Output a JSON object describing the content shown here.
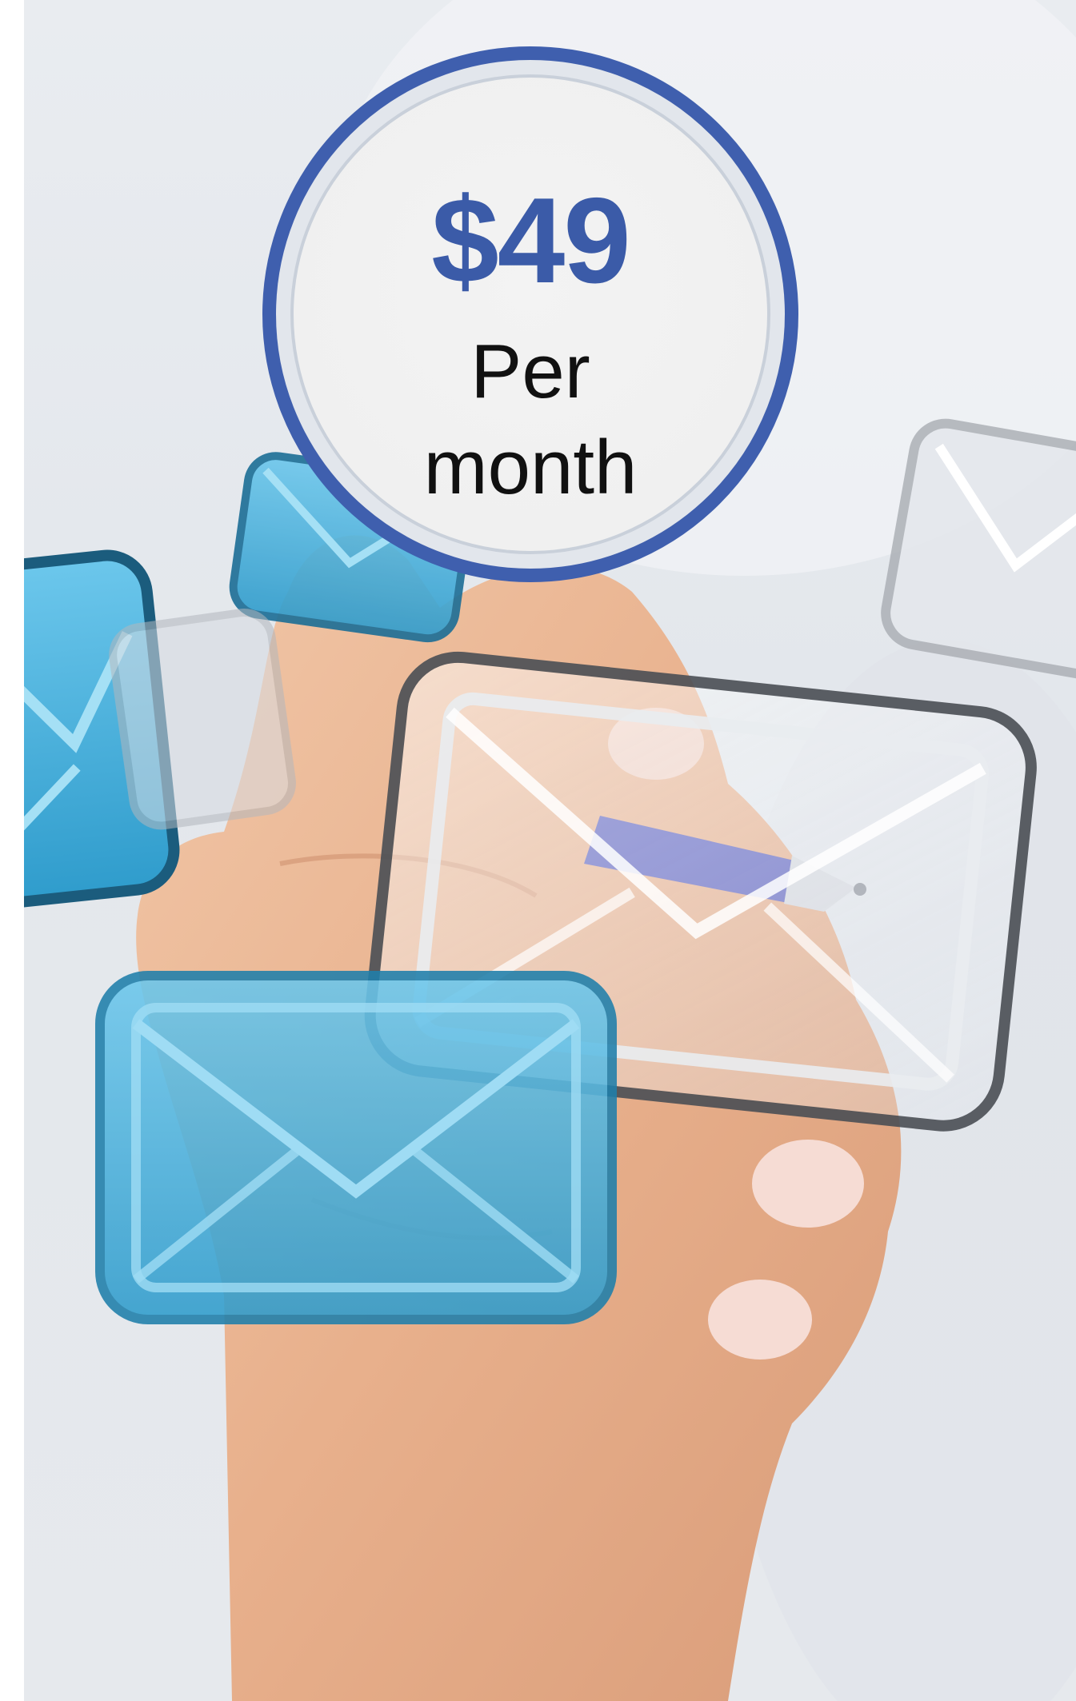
{
  "pricing": {
    "amount": "$49",
    "period_line1": "Per",
    "period_line2": "month"
  },
  "colors": {
    "badge_ring": "#3f5fae",
    "price_text": "#3b5ba8",
    "period_text": "#111111",
    "badge_fill": "#f0f0f0",
    "envelope_blue": "#3fa8d6"
  },
  "scene": {
    "background_icons": [
      "envelope-icon",
      "envelope-icon",
      "envelope-icon",
      "envelope-icon",
      "envelope-icon",
      "envelope-icon"
    ],
    "subject": "hand-holding-pen"
  }
}
